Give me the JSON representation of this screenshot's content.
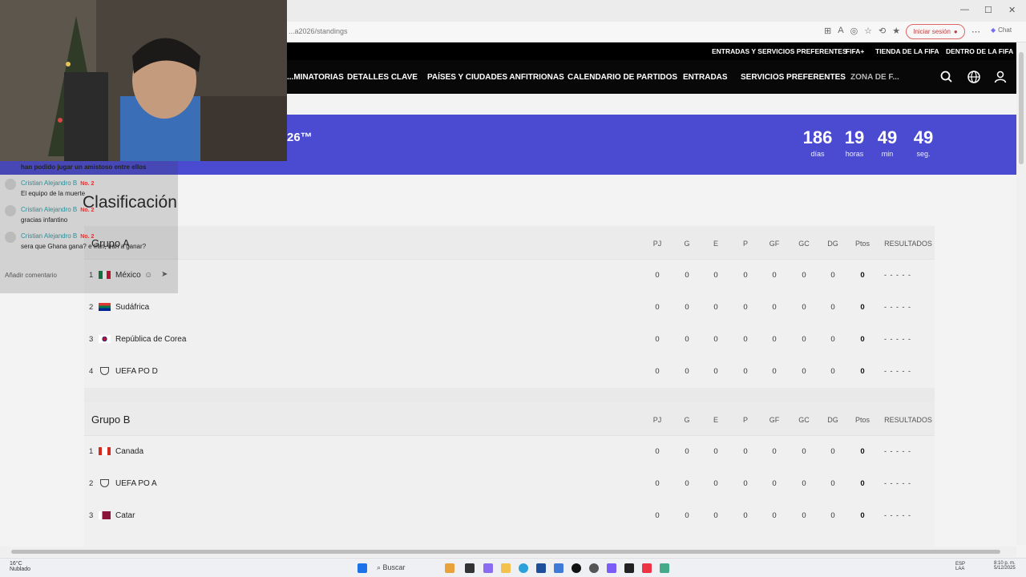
{
  "browser": {
    "url": "...a2026/standings",
    "signin_label": "Iniciar sesión",
    "copilot_label": "Chat"
  },
  "fifa": {
    "top_links": [
      "ENTRADAS Y SERVICIOS PREFERENTES",
      "FIFA+",
      "TIENDA DE LA FIFA",
      "DENTRO DE LA FIFA"
    ],
    "nav_items": [
      "...MINATORIAS",
      "DETALLES CLAVE",
      "PAÍSES Y CIUDADES ANFITRIONAS",
      "CALENDARIO DE PARTIDOS",
      "ENTRADAS",
      "SERVICIOS PREFERENTES",
      "ZONA DE F..."
    ]
  },
  "banner": {
    "title": "26™",
    "countdown": [
      {
        "value": "186",
        "label": "días"
      },
      {
        "value": "19",
        "label": "horas"
      },
      {
        "value": "49",
        "label": "min"
      },
      {
        "value": "49",
        "label": "seg."
      }
    ]
  },
  "page_title": "Clasificación",
  "columns": [
    "PJ",
    "G",
    "E",
    "P",
    "GF",
    "GC",
    "DG",
    "Ptos",
    "RESULTADOS"
  ],
  "groups": [
    {
      "name": "Grupo A",
      "rows": [
        {
          "pos": "1",
          "team": "México",
          "stats": [
            "0",
            "0",
            "0",
            "0",
            "0",
            "0",
            "0",
            "0"
          ],
          "results": "- - - - -"
        },
        {
          "pos": "2",
          "team": "Sudáfrica",
          "stats": [
            "0",
            "0",
            "0",
            "0",
            "0",
            "0",
            "0",
            "0"
          ],
          "results": "- - - - -"
        },
        {
          "pos": "3",
          "team": "República de Corea",
          "stats": [
            "0",
            "0",
            "0",
            "0",
            "0",
            "0",
            "0",
            "0"
          ],
          "results": "- - - - -"
        },
        {
          "pos": "4",
          "team": "UEFA PO D",
          "stats": [
            "0",
            "0",
            "0",
            "0",
            "0",
            "0",
            "0",
            "0"
          ],
          "results": "- - - - -"
        }
      ]
    },
    {
      "name": "Grupo B",
      "rows": [
        {
          "pos": "1",
          "team": "Canada",
          "stats": [
            "0",
            "0",
            "0",
            "0",
            "0",
            "0",
            "0",
            "0"
          ],
          "results": "- - - - -"
        },
        {
          "pos": "2",
          "team": "UEFA PO A",
          "stats": [
            "0",
            "0",
            "0",
            "0",
            "0",
            "0",
            "0",
            "0"
          ],
          "results": "- - - - -"
        },
        {
          "pos": "3",
          "team": "Catar",
          "stats": [
            "0",
            "0",
            "0",
            "0",
            "0",
            "0",
            "0",
            "0"
          ],
          "results": "- - - - -"
        }
      ]
    }
  ],
  "chat": {
    "messages": [
      {
        "author": "",
        "text": "han podido jugar un amistoso entre ellos"
      },
      {
        "author": "Cristian Alejandro B",
        "badge": "No. 2",
        "text": "El equipo de la muerte"
      },
      {
        "author": "Cristian Alejandro B",
        "badge": "No. 2",
        "text": "gracias infantino"
      },
      {
        "author": "Cristian Alejandro B",
        "badge": "No. 2",
        "text": "sera que Ghana gana? e Iran, iran a ganar?"
      }
    ],
    "input_placeholder": "Añadir comentario"
  },
  "taskbar": {
    "search_label": "Buscar",
    "weather": "16°C",
    "weather_sub": "Nublado",
    "clock_time": "8:10 p. m.",
    "clock_date": "5/12/2025",
    "lang": "ESP LAA"
  },
  "colors": {
    "banner": "#4a4bd1",
    "nav_bg": "#000000",
    "accent_badge": "#dd3333"
  }
}
